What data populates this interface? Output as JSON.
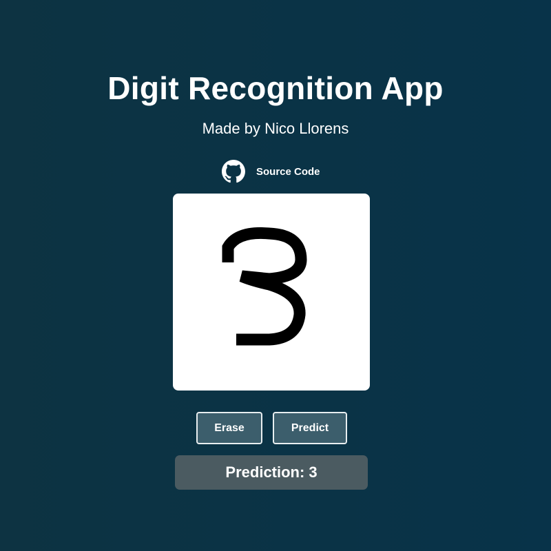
{
  "app": {
    "title": "Digit Recognition App",
    "subtitle": "Made by Nico Llorens"
  },
  "source": {
    "icon": "github-icon",
    "label": "Source Code"
  },
  "canvas": {
    "background_color": "#ffffff",
    "stroke_color": "#000000",
    "drawn_digit": "3"
  },
  "buttons": {
    "erase_label": "Erase",
    "predict_label": "Predict"
  },
  "prediction": {
    "label": "Prediction:",
    "value": "3"
  },
  "colors": {
    "background": "#0b3345",
    "button_bg": "#3c5e6c",
    "prediction_bg": "#4b5b61"
  }
}
